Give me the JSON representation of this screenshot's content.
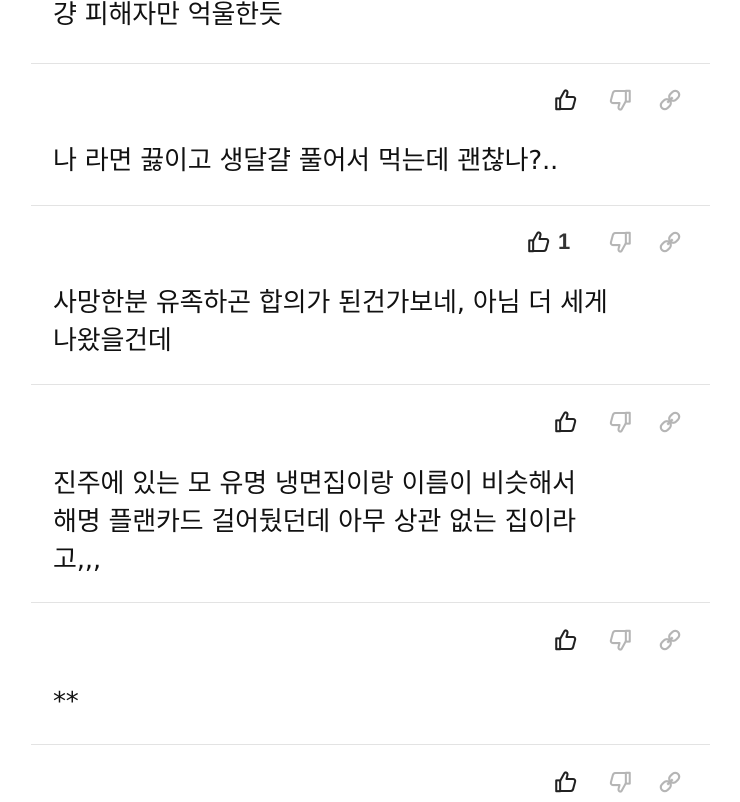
{
  "comments": [
    {
      "text": "걍 피해자만 억울한듯",
      "likes": ""
    },
    {
      "text": "나 라면 끓이고 생달걀 풀어서 먹는데 괜찮나?..",
      "likes": "1"
    },
    {
      "text": "사망한분 유족하곤 합의가 된건가보네, 아님 더 세게\n나왔을건데",
      "likes": ""
    },
    {
      "text": "진주에 있는 모 유명 냉면집이랑 이름이 비슷해서\n해명 플랜카드 걸어뒀던데 아무 상관 없는 집이라\n고,,,",
      "likes": ""
    },
    {
      "text": "**",
      "likes": ""
    }
  ],
  "icons": {
    "like": "thumbs-up-icon",
    "dislike": "thumbs-down-icon",
    "share": "link-icon"
  },
  "colors": {
    "text": "#111111",
    "like_icon": "#222222",
    "inactive_icon": "#b5b5b5",
    "divider": "#e3e3e3"
  }
}
